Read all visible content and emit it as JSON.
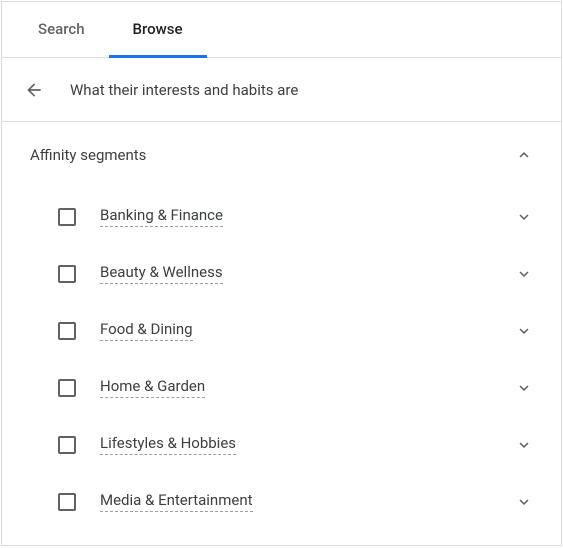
{
  "tabs": {
    "search": "Search",
    "browse": "Browse",
    "active": "browse"
  },
  "breadcrumb": {
    "title": "What their interests and habits are"
  },
  "section": {
    "title": "Affinity segments",
    "items": [
      {
        "label": "Banking & Finance"
      },
      {
        "label": "Beauty & Wellness"
      },
      {
        "label": "Food & Dining"
      },
      {
        "label": "Home & Garden"
      },
      {
        "label": "Lifestyles & Hobbies"
      },
      {
        "label": "Media & Entertainment"
      }
    ]
  }
}
